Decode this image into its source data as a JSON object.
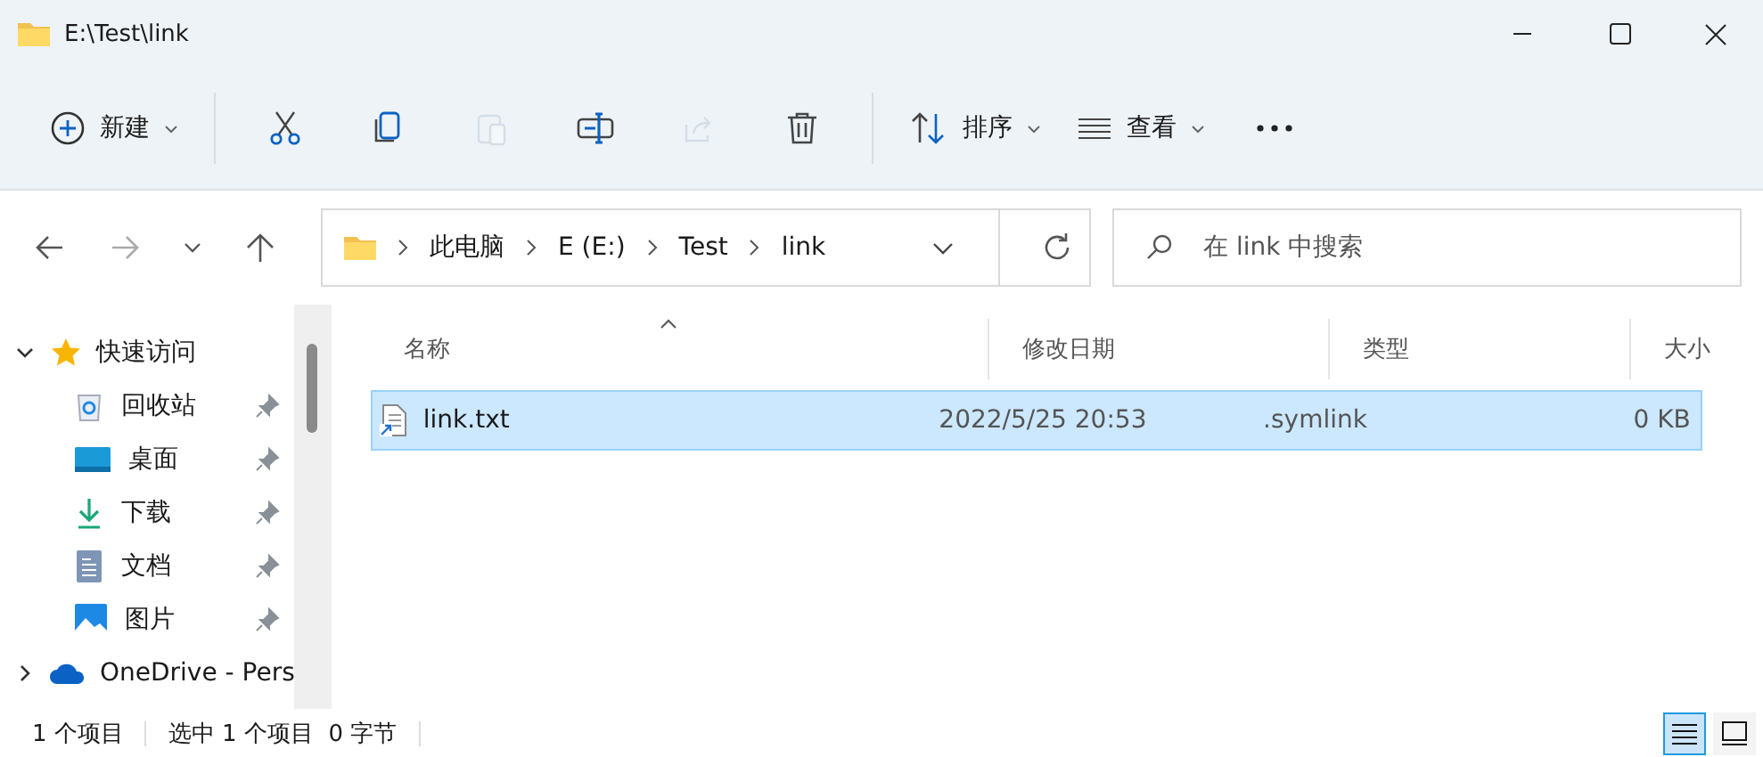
{
  "window": {
    "title": "E:\\Test\\link"
  },
  "toolbar": [
    {
      "kind": "new",
      "label": "新建",
      "dropdown": true,
      "disabled": false
    },
    {
      "kind": "cut",
      "disabled": false
    },
    {
      "kind": "copy",
      "disabled": false
    },
    {
      "kind": "paste",
      "disabled": true
    },
    {
      "kind": "rename",
      "disabled": false
    },
    {
      "kind": "share",
      "disabled": true
    },
    {
      "kind": "delete",
      "disabled": false
    },
    {
      "kind": "sort",
      "label": "排序",
      "dropdown": true,
      "disabled": false
    },
    {
      "kind": "view",
      "label": "查看",
      "dropdown": true,
      "disabled": false
    },
    {
      "kind": "more",
      "disabled": false
    }
  ],
  "address": {
    "segments": [
      "此电脑",
      "E (E:)",
      "Test",
      "link"
    ]
  },
  "search": {
    "placeholder": "在 link 中搜索"
  },
  "sidebar": {
    "items": [
      {
        "kind": "star",
        "label": "快速访问",
        "expanded": true,
        "children": [
          {
            "kind": "recycle",
            "label": "回收站",
            "pinned": true
          },
          {
            "kind": "desktop",
            "label": "桌面",
            "pinned": true
          },
          {
            "kind": "download",
            "label": "下载",
            "pinned": true
          },
          {
            "kind": "document",
            "label": "文档",
            "pinned": true
          },
          {
            "kind": "pictures",
            "label": "图片",
            "pinned": true
          }
        ]
      },
      {
        "kind": "cloud",
        "label": "OneDrive - Pers",
        "expanded": false
      }
    ]
  },
  "table": {
    "columns": [
      "名称",
      "修改日期",
      "类型",
      "大小"
    ],
    "rows": [
      {
        "name": "link.txt",
        "modified": "2022/5/25 20:53",
        "type": ".symlink",
        "size": "0 KB",
        "selected": true
      }
    ]
  },
  "status_bar": {
    "count": "1 个项目",
    "selection": "选中 1 个项目  0 字节"
  },
  "view_buttons": [
    {
      "kind": "details",
      "selected": true
    },
    {
      "kind": "tiles",
      "selected": false
    }
  ]
}
